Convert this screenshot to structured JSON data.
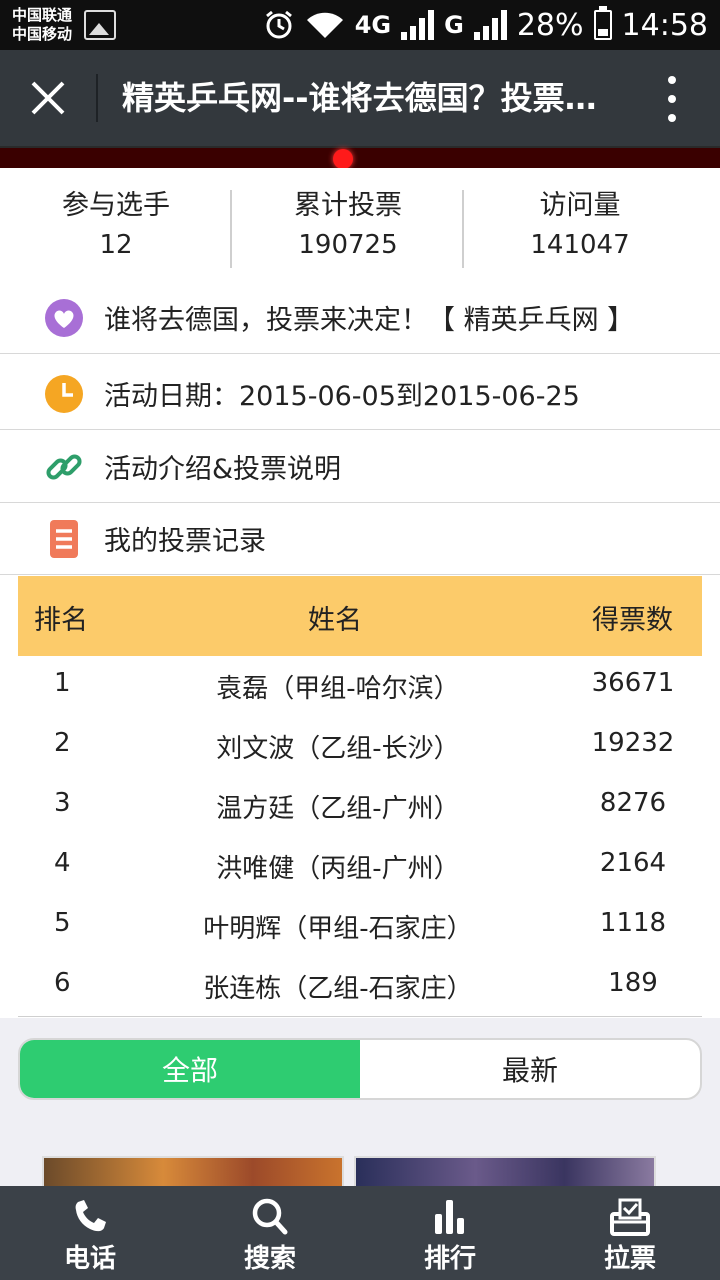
{
  "status_bar": {
    "carrier_line1": "中国联通",
    "carrier_line2": "中国移动",
    "network_1": "4G",
    "network_2": "G",
    "battery": "28%",
    "battery_level": 0.28,
    "time": "14:58"
  },
  "title_bar": {
    "title": "精英乒乓网--谁将去德国？投票来决定！",
    "close_icon": "close-icon",
    "more_icon": "more-vertical-icon"
  },
  "stats": [
    {
      "label": "参与选手",
      "value": "12"
    },
    {
      "label": "累计投票",
      "value": "190725"
    },
    {
      "label": "访问量",
      "value": "141047"
    }
  ],
  "info_rows": [
    {
      "icon": "heart-icon",
      "text": "谁将去德国，投票来决定！【 精英乒乓网 】",
      "color": "#a86fd6"
    },
    {
      "icon": "clock-icon",
      "text": "活动日期：2015-06-05到2015-06-25",
      "color": "#f5a623"
    },
    {
      "icon": "link-icon",
      "text": "活动介绍&投票说明",
      "color": "#2e9e6a"
    },
    {
      "icon": "list-icon",
      "text": "我的投票记录",
      "color": "#f07a5a"
    }
  ],
  "ranking": {
    "headers": {
      "rank": "排名",
      "name": "姓名",
      "votes": "得票数"
    },
    "rows": [
      {
        "rank": "1",
        "name": "袁磊（甲组-哈尔滨）",
        "votes": "36671"
      },
      {
        "rank": "2",
        "name": "刘文波（乙组-长沙）",
        "votes": "19232"
      },
      {
        "rank": "3",
        "name": "温方廷（乙组-广州）",
        "votes": "8276"
      },
      {
        "rank": "4",
        "name": "洪唯健（丙组-广州）",
        "votes": "2164"
      },
      {
        "rank": "5",
        "name": "叶明辉（甲组-石家庄）",
        "votes": "1118"
      },
      {
        "rank": "6",
        "name": "张连栋（乙组-石家庄）",
        "votes": "189"
      }
    ],
    "header_color": "#fccb6a"
  },
  "tabs": [
    {
      "label": "全部",
      "active": true
    },
    {
      "label": "最新",
      "active": false
    }
  ],
  "bottom_nav": [
    {
      "label": "电话",
      "icon": "phone-icon"
    },
    {
      "label": "搜索",
      "icon": "search-icon"
    },
    {
      "label": "排行",
      "icon": "bar-chart-icon"
    },
    {
      "label": "拉票",
      "icon": "ballot-box-icon"
    }
  ],
  "colors": {
    "accent_green": "#2ecc71",
    "title_bar": "#33383d",
    "bottom_nav": "#3b4148"
  }
}
